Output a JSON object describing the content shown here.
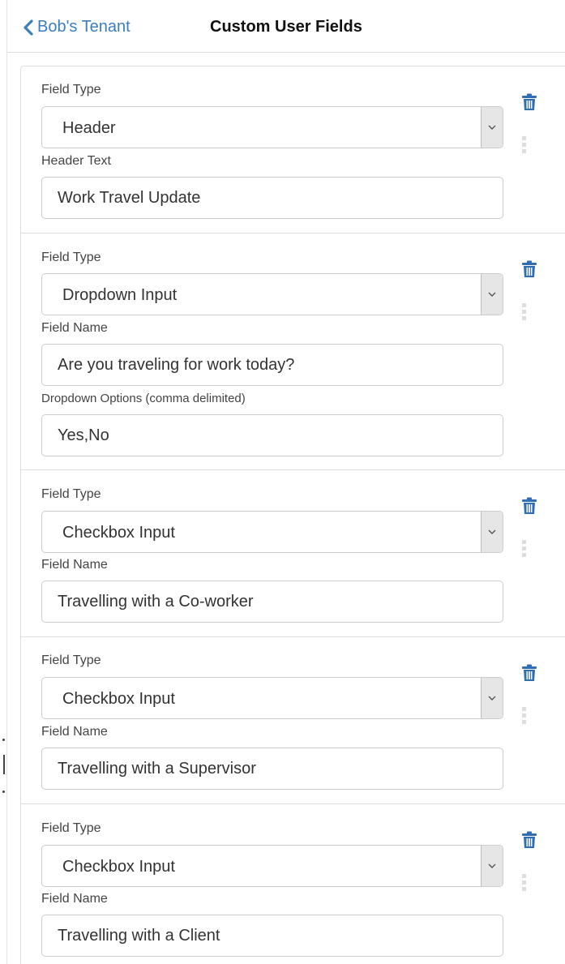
{
  "header": {
    "back_label": "Bob's Tenant",
    "title": "Custom User Fields"
  },
  "icons": {
    "back": "chevron-left-icon",
    "delete": "trash-icon",
    "drag": "drag-handle-icon",
    "dropdown": "chevron-down-icon"
  },
  "colors": {
    "link": "#3a7ebf",
    "icon": "#2f6db5"
  },
  "fields": [
    {
      "type_label": "Field Type",
      "type_value": "Header",
      "name_label": "Header Text",
      "name_value": "Work Travel Update"
    },
    {
      "type_label": "Field Type",
      "type_value": "Dropdown Input",
      "name_label": "Field Name",
      "name_value": "Are you traveling for work today?",
      "options_label": "Dropdown Options (comma delimited)",
      "options_value": "Yes,No"
    },
    {
      "type_label": "Field Type",
      "type_value": "Checkbox Input",
      "name_label": "Field Name",
      "name_value": "Travelling with a Co-worker"
    },
    {
      "type_label": "Field Type",
      "type_value": "Checkbox Input",
      "name_label": "Field Name",
      "name_value": "Travelling with a Supervisor"
    },
    {
      "type_label": "Field Type",
      "type_value": "Checkbox Input",
      "name_label": "Field Name",
      "name_value": "Travelling with a Client"
    }
  ]
}
